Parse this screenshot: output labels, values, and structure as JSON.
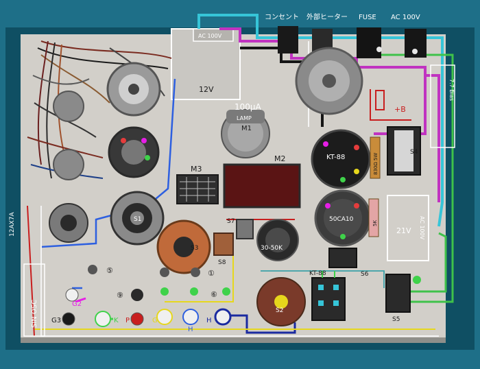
{
  "header": {
    "outlet": "コンセント",
    "external_heater": "外部ヒーター",
    "fuse": "FUSE",
    "ac": "AC 100V"
  },
  "boxes": {
    "ac100v_small": "AC 100V",
    "v12": "12V",
    "v21": "21V",
    "ac100_vertical": "AC 100V"
  },
  "meters": {
    "m1_range": "100μA",
    "m1_lamp": "LAMP",
    "m1": "M1",
    "m2": "M2",
    "m3": "M3"
  },
  "tubes": {
    "kt88_main": "KT-88",
    "tube_50ca10": "50CA10",
    "kt88_small": "KT-88",
    "twelve_ax7a": "12AX7A"
  },
  "resistors": {
    "r_830": "830Ω 5W",
    "r_5k": "5K"
  },
  "switches": {
    "s1": "S1",
    "s2": "S2",
    "s3": "S3",
    "s4": "S4",
    "s5": "S5",
    "s6": "S6",
    "s7": "S7",
    "s8": "S8"
  },
  "labels": {
    "plus_b": "+B",
    "pot": "30-50K",
    "sin_osc": "SIN OSC",
    "num1": "①",
    "num5": "⑤",
    "num6": "⑥",
    "num9": "⑨",
    "vertical_right": "7.7 Bias"
  },
  "jacks": {
    "g2": "G2",
    "g3": "G3",
    "k": "K",
    "p": "P",
    "g": "G",
    "h1": "H",
    "h2": "H"
  }
}
